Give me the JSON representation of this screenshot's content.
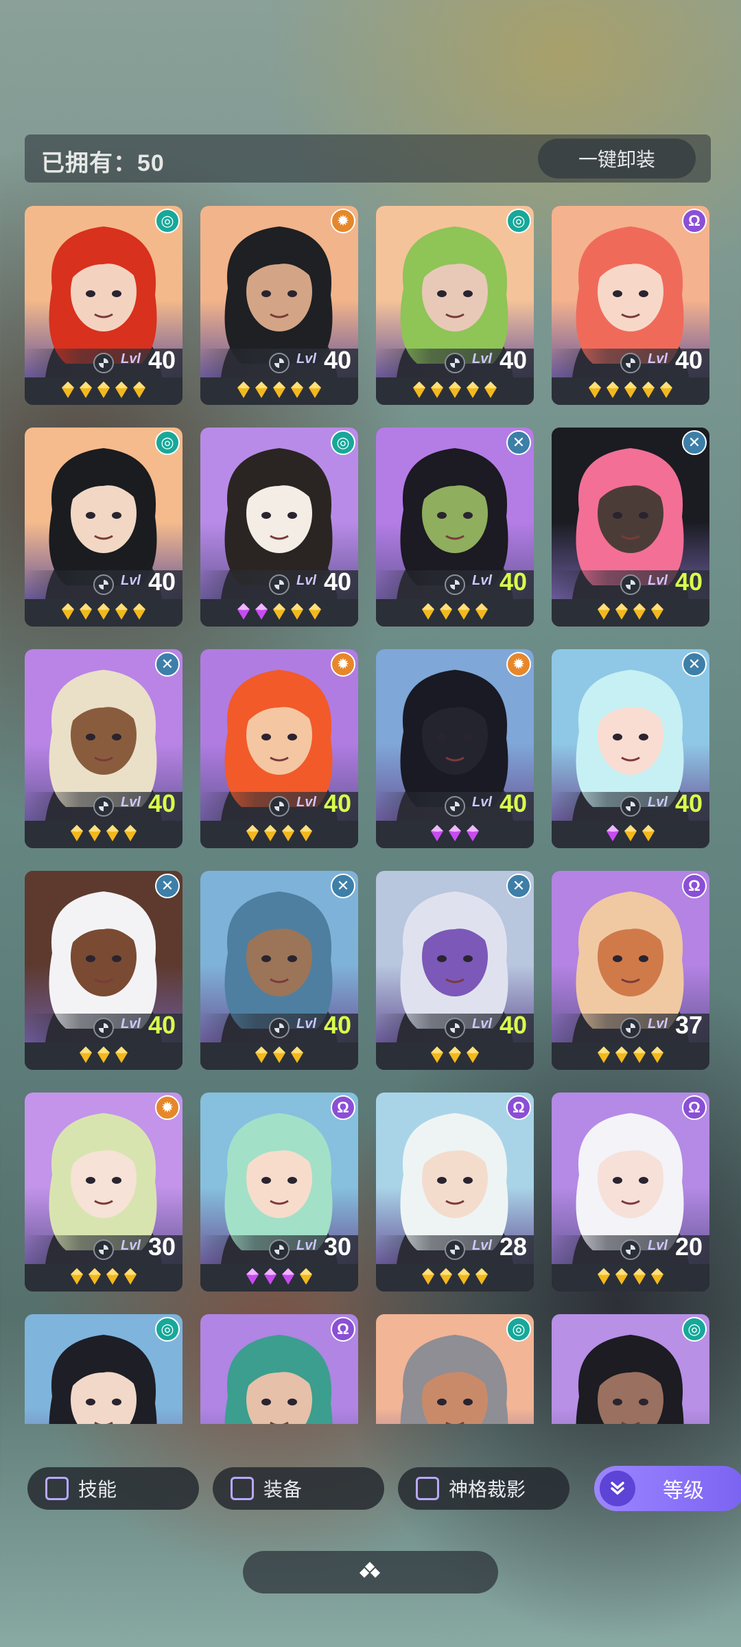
{
  "header": {
    "owned_label": "已拥有：50",
    "unequip_label": "一键卸装"
  },
  "level_label": "Lvl",
  "colors": {
    "gold_star": "#f2b81d",
    "purple_star": "#c84bf0",
    "max_level": "#d9ff4a",
    "accent": "#8a74f6"
  },
  "cards": [
    {
      "faction": "swirl-icon",
      "level": "40",
      "stars": [
        "gold",
        "gold",
        "gold",
        "gold",
        "gold"
      ],
      "bg": "#f4b98a",
      "hair": "#d8311e",
      "skin": "#f3d3c0"
    },
    {
      "faction": "sun-icon",
      "level": "40",
      "stars": [
        "gold",
        "gold",
        "gold",
        "gold",
        "gold"
      ],
      "bg": "#f2b48a",
      "hair": "#1e2024",
      "skin": "#d3a586"
    },
    {
      "faction": "swirl-icon",
      "level": "40",
      "stars": [
        "gold",
        "gold",
        "gold",
        "gold",
        "gold"
      ],
      "bg": "#f5c39a",
      "hair": "#8fc457",
      "skin": "#e8c9b8"
    },
    {
      "faction": "omega-icon",
      "level": "40",
      "stars": [
        "gold",
        "gold",
        "gold",
        "gold",
        "gold"
      ],
      "bg": "#f4b28e",
      "hair": "#f06a5a",
      "skin": "#f7d8c8"
    },
    {
      "faction": "swirl-icon",
      "level": "40",
      "stars": [
        "gold",
        "gold",
        "gold",
        "gold",
        "gold"
      ],
      "bg": "#f6bb8c",
      "hair": "#1a1c20",
      "skin": "#f1d7c4"
    },
    {
      "faction": "swirl-icon",
      "level": "40",
      "stars": [
        "purple",
        "purple",
        "gold",
        "gold",
        "gold"
      ],
      "bg": "#b98be8",
      "hair": "#2a2522",
      "skin": "#f3ede6"
    },
    {
      "faction": "cross-icon",
      "level": "40",
      "stars": [
        "gold",
        "gold",
        "gold",
        "gold"
      ],
      "bg": "#b47de6",
      "hair": "#1c1a22",
      "skin": "#8fae5e"
    },
    {
      "faction": "cross-icon",
      "level": "40",
      "stars": [
        "gold",
        "gold",
        "gold",
        "gold"
      ],
      "bg": "#1a1c22",
      "hair": "#f36f96",
      "skin": "#4c3c38"
    },
    {
      "faction": "cross-icon",
      "level": "40",
      "stars": [
        "gold",
        "gold",
        "gold",
        "gold"
      ],
      "bg": "#b984e6",
      "hair": "#eae0c8",
      "skin": "#8a5c3e"
    },
    {
      "faction": "sun-icon",
      "level": "40",
      "stars": [
        "gold",
        "gold",
        "gold",
        "gold"
      ],
      "bg": "#b07ce2",
      "hair": "#f25a2a",
      "skin": "#f5c6a2"
    },
    {
      "faction": "sun-icon",
      "level": "40",
      "stars": [
        "purple",
        "purple",
        "purple"
      ],
      "bg": "#7fa7d8",
      "hair": "#1a1a24",
      "skin": "#24242e"
    },
    {
      "faction": "cross-icon",
      "level": "40",
      "stars": [
        "purple",
        "gold",
        "gold"
      ],
      "bg": "#8fc8e6",
      "hair": "#c7f0f4",
      "skin": "#f9ddd2"
    },
    {
      "faction": "cross-icon",
      "level": "40",
      "stars": [
        "gold",
        "gold",
        "gold"
      ],
      "bg": "#5e3a2e",
      "hair": "#f3f3f6",
      "skin": "#7a4a32"
    },
    {
      "faction": "cross-icon",
      "level": "40",
      "stars": [
        "gold",
        "gold",
        "gold"
      ],
      "bg": "#7fb2d8",
      "hair": "#4e7fa0",
      "skin": "#9c7458"
    },
    {
      "faction": "cross-icon",
      "level": "40",
      "stars": [
        "gold",
        "gold",
        "gold"
      ],
      "bg": "#b8c6de",
      "hair": "#dfe2ee",
      "skin": "#7c58b8"
    },
    {
      "faction": "omega-icon",
      "level": "37",
      "stars": [
        "gold",
        "gold",
        "gold",
        "gold"
      ],
      "bg": "#b483e4",
      "hair": "#f0c9a2",
      "skin": "#d07a4a"
    },
    {
      "faction": "sun-icon",
      "level": "30",
      "stars": [
        "gold",
        "gold",
        "gold",
        "gold"
      ],
      "bg": "#c394ea",
      "hair": "#d8e4b0",
      "skin": "#f6e2d6"
    },
    {
      "faction": "omega-icon",
      "level": "30",
      "stars": [
        "purple",
        "purple",
        "purple",
        "gold"
      ],
      "bg": "#86c0de",
      "hair": "#a3e0c8",
      "skin": "#f7dccc"
    },
    {
      "faction": "omega-icon",
      "level": "28",
      "stars": [
        "gold",
        "gold",
        "gold",
        "gold"
      ],
      "bg": "#a9d4e8",
      "hair": "#eef4f4",
      "skin": "#f4dccd"
    },
    {
      "faction": "omega-icon",
      "level": "20",
      "stars": [
        "gold",
        "gold",
        "gold",
        "gold"
      ],
      "bg": "#b48ae6",
      "hair": "#f3f3f8",
      "skin": "#f6e0d8"
    },
    {
      "faction": "swirl-icon",
      "level": "",
      "stars": [],
      "bg": "#7fb4dc",
      "hair": "#1e1e26",
      "skin": "#f2d8c8"
    },
    {
      "faction": "omega-icon",
      "level": "",
      "stars": [],
      "bg": "#b085e4",
      "hair": "#3c9e8e",
      "skin": "#e6c0a8"
    },
    {
      "faction": "swirl-icon",
      "level": "",
      "stars": [],
      "bg": "#f2b596",
      "hair": "#8e8e94",
      "skin": "#c98a6a"
    },
    {
      "faction": "swirl-icon",
      "level": "",
      "stars": [],
      "bg": "#b890e6",
      "hair": "#1c1c22",
      "skin": "#9a7060"
    }
  ],
  "filters": [
    {
      "label": "技能"
    },
    {
      "label": "装备"
    },
    {
      "label": "神格裁影"
    }
  ],
  "sort_label": "等级"
}
